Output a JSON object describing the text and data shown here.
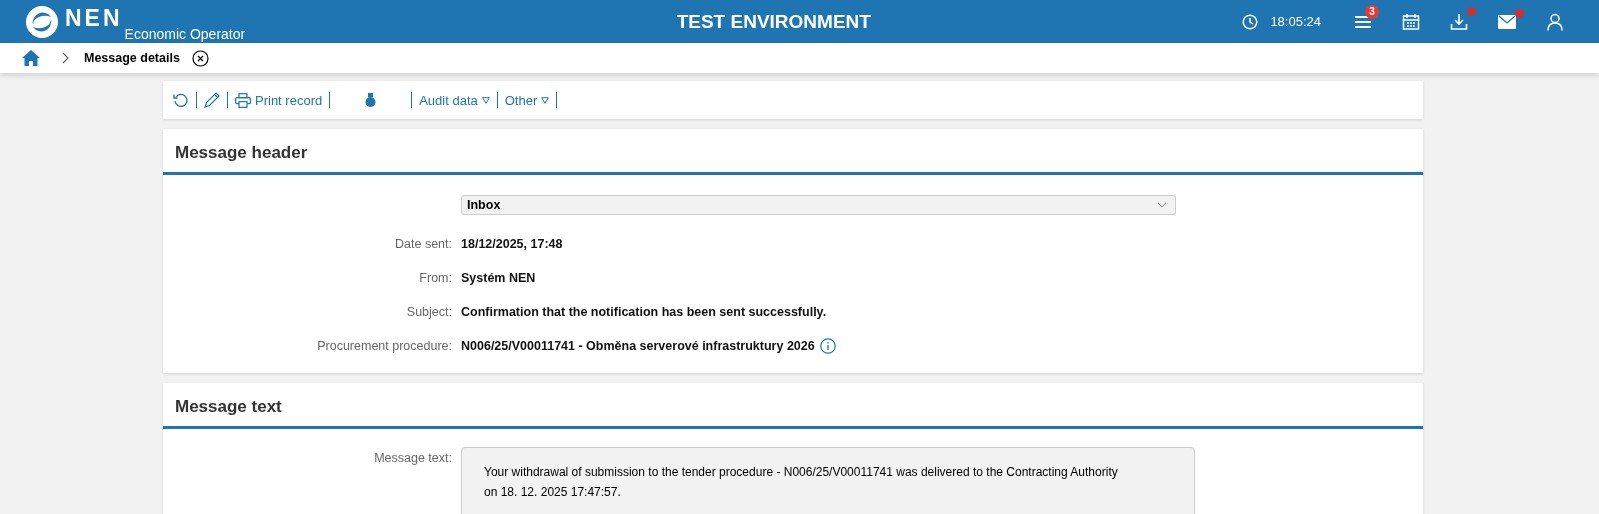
{
  "header": {
    "logo_text": "NEN",
    "subtitle": "Economic Operator",
    "environment": "TEST ENVIRONMENT",
    "time": "18:05:24",
    "icons": [
      {
        "kind": "menu",
        "badge": "3",
        "dot": false
      },
      {
        "kind": "calendar",
        "dot": false
      },
      {
        "kind": "download",
        "dot": true
      },
      {
        "kind": "mail",
        "dot": true
      },
      {
        "kind": "user",
        "dot": false
      }
    ]
  },
  "breadcrumb": {
    "current": "Message details"
  },
  "toolbar": [
    {
      "kind": "refresh"
    },
    {
      "kind": "edit"
    },
    {
      "kind": "print",
      "label": "Print record"
    },
    {
      "kind": "medal"
    },
    {
      "kind": "dropdown",
      "label": "Audit data"
    },
    {
      "kind": "dropdown",
      "label": "Other"
    }
  ],
  "sections": [
    {
      "title": "Message header",
      "fields": [
        {
          "kind": "select",
          "value": "Inbox"
        },
        {
          "kind": "text",
          "label": "Date sent:",
          "value": "18/12/2025, 17:48",
          "info": false
        },
        {
          "kind": "text",
          "label": "From:",
          "value": "Systém NEN",
          "info": false
        },
        {
          "kind": "text",
          "label": "Subject:",
          "value": "Confirmation that the notification has been sent successfully.",
          "info": false
        },
        {
          "kind": "text",
          "label": "Procurement procedure:",
          "value": "N006/25/V00011741 - Obměna serverové infrastruktury 2026",
          "info": true
        }
      ]
    },
    {
      "title": "Message text",
      "fields": [
        {
          "kind": "textarea",
          "label": "Message text:",
          "value": "Your withdrawal of submission to the tender procedure - N006/25/V00011741 was delivered to the Contracting Authority on 18. 12. 2025 17:47:57."
        }
      ]
    }
  ]
}
